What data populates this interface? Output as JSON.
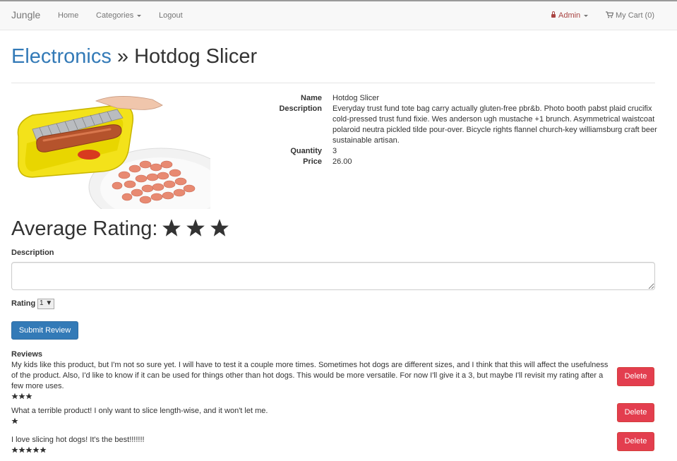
{
  "navbar": {
    "brand": "Jungle",
    "home": "Home",
    "categories": "Categories",
    "logout": "Logout",
    "admin": "Admin",
    "cart": "My Cart (0)"
  },
  "page": {
    "category": "Electronics",
    "separator": " » ",
    "product_title": "Hotdog Slicer"
  },
  "product": {
    "name_label": "Name",
    "name": "Hotdog Slicer",
    "description_label": "Description",
    "description": "Everyday trust fund tote bag carry actually gluten-free pbr&b. Photo booth pabst plaid crucifix cold-pressed trust fund fixie. Wes anderson ugh mustache +1 brunch. Asymmetrical waistcoat polaroid neutra pickled tilde pour-over. Bicycle rights flannel church-key williamsburg craft beer sustainable artisan.",
    "quantity_label": "Quantity",
    "quantity": "3",
    "price_label": "Price",
    "price": "26.00",
    "image_icon": "hotdog-slicer-product-photo"
  },
  "rating": {
    "heading": "Average Rating:",
    "average_stars": 3
  },
  "review_form": {
    "description_label": "Description",
    "description_value": "",
    "rating_label": "Rating",
    "rating_selected": "1",
    "submit_label": "Submit Review"
  },
  "reviews": {
    "heading": "Reviews",
    "items": [
      {
        "text": "My kids like this product, but I'm not so sure yet. I will have to test it a couple more times. Sometimes hot dogs are different sizes, and I think that this will affect the usefulness of the product. Also, I'd like to know if it can be used for things other than hot dogs. This would be more versatile. For now I'll give it a 3, but maybe I'll revisit my rating after a few more uses.",
        "stars": 3,
        "delete_label": "Delete"
      },
      {
        "text": "What a terrible product! I only want to slice length-wise, and it won't let me.",
        "stars": 1,
        "delete_label": "Delete"
      },
      {
        "text": "I love slicing hot dogs! It's the best!!!!!!!",
        "stars": 5,
        "delete_label": "Delete"
      }
    ]
  },
  "colors": {
    "link": "#337ab7",
    "admin": "#a94442",
    "primary_button": "#337ab7",
    "danger_button": "#e33e4f"
  }
}
